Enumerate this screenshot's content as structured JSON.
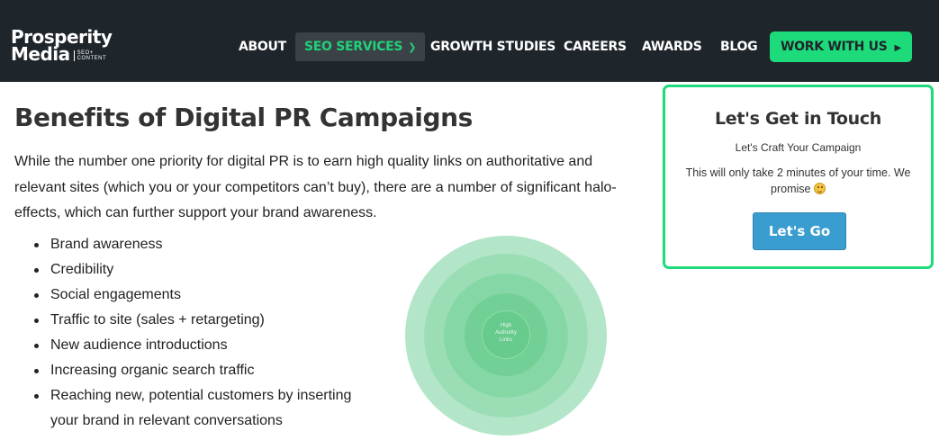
{
  "header": {
    "logo": {
      "line1": "Prosperity",
      "line2": "Media",
      "tag1": "SEO+",
      "tag2": "CONTENT"
    },
    "nav": [
      {
        "label": "ABOUT"
      },
      {
        "label": "SEO SERVICES"
      },
      {
        "label": "GROWTH STUDIES"
      },
      {
        "label": "CAREERS"
      },
      {
        "label": "AWARDS"
      },
      {
        "label": "BLOG"
      }
    ],
    "cta_label": "WORK WITH US",
    "icons": {
      "seo_dropdown": "chevron-down-icon",
      "cta_arrow": "play-arrow-icon"
    },
    "colors": {
      "background": "#1e252b",
      "accent_green": "#1ddb7a"
    }
  },
  "main": {
    "title": "Benefits of Digital PR Campaigns",
    "intro": "While the number one priority for digital PR is to earn high quality links on authoritative and relevant sites (which you or your competitors can’t buy), there are a number of significant halo-effects, which can further support your brand awareness.",
    "benefits": [
      "Brand awareness",
      "Credibility",
      "Social engagements",
      "Traffic to site (sales + retargeting)",
      "New audience introductions",
      "Increasing organic search traffic",
      "Reaching new, potential customers by inserting your brand in relevant conversations"
    ],
    "graphic": {
      "core_label_1": "High",
      "core_label_2": "Authority",
      "core_label_3": "Links"
    }
  },
  "sidebar": {
    "card": {
      "title": "Let's Get in Touch",
      "subtitle": "Let's Craft Your Campaign",
      "text": "This will only take 2 minutes of your time. We promise",
      "emoji": "smiling-face-icon",
      "button_label": "Let's Go",
      "button_color": "#3a9dcf"
    }
  }
}
